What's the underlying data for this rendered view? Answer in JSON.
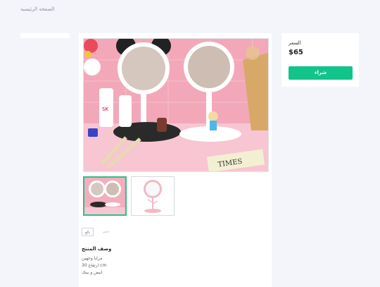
{
  "header": {
    "breadcrumb": "الصفحة الرئيسية"
  },
  "product": {
    "tags": [
      "بالغ",
      "حجم"
    ],
    "description_title": "وصف المنتج",
    "description_lines": [
      "مرايا وجهين",
      "30 ارتفاع cm",
      "ابيض و بينك"
    ]
  },
  "sidebar": {
    "price_label": "السعر",
    "price_value": "$65",
    "buy_label": "شراء"
  },
  "colors": {
    "accent": "#10c48a",
    "selected_thumb_border": "#2fbf84",
    "background": "#f3f5fa"
  }
}
